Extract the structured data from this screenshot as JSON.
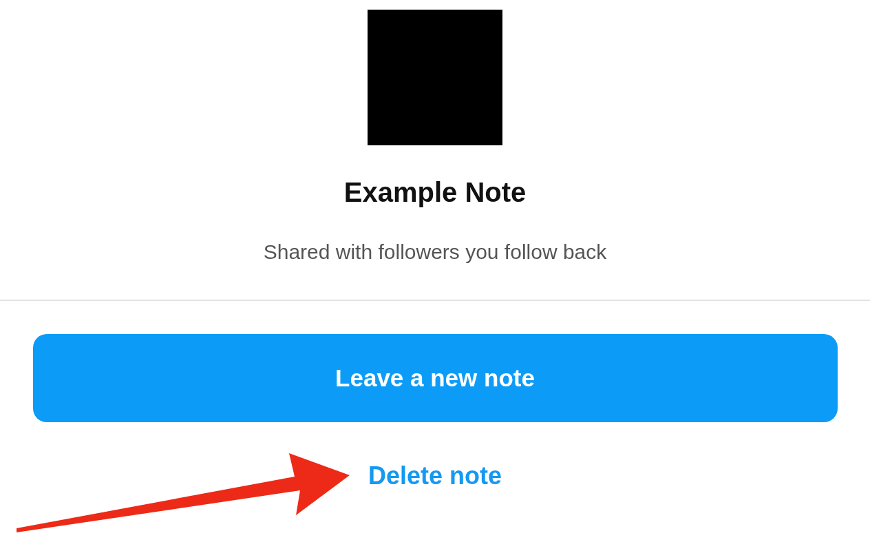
{
  "note": {
    "title": "Example Note",
    "audience": "Shared with followers you follow back"
  },
  "buttons": [
    {
      "label": "Leave a new note",
      "kind": "primary"
    },
    {
      "label": "Delete note",
      "kind": "link"
    }
  ]
}
